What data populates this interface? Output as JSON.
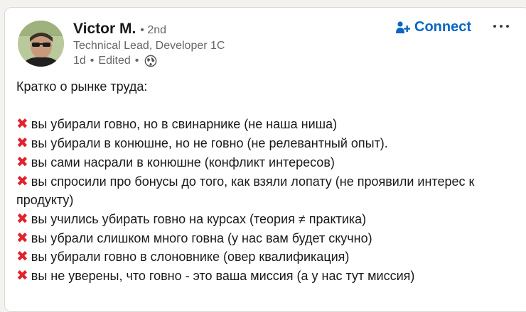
{
  "post": {
    "author": {
      "name": "Victor M.",
      "degree": "• 2nd",
      "headline": "Technical Lead, Developer 1C",
      "time": "1d",
      "edited": "Edited"
    },
    "actions": {
      "connect_label": "Connect",
      "connect_icon": "add-person-icon",
      "more_icon": "more-icon"
    },
    "intro": "Кратко о рынке труда:",
    "bullet_icon": "cross-mark-icon",
    "bullets": [
      "вы убирали говно, но в свинарнике (не наша ниша)",
      "вы убирали в конюшне, но не говно (не релевантный опыт).",
      "вы сами насрали в конюшне (конфликт интересов)",
      "вы спросили про бонусы до того, как взяли лопату (не проявили интерес к продукту)",
      "вы учились убирать говно на курсах (теория ≠ практика)",
      "вы убрали слишком много говна (у нас вам будет скучно)",
      "вы убирали говно в слоновнике (овер квалификация)",
      "вы не уверены, что говно - это ваша миссия (а у нас тут миссия)"
    ],
    "accent_color": "#0a66c2",
    "cross_color": "#e0232e"
  }
}
